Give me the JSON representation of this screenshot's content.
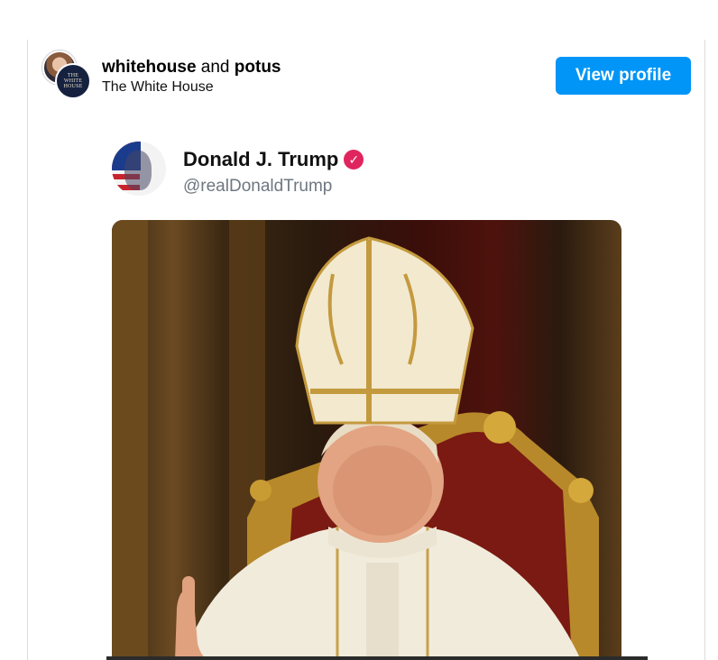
{
  "post": {
    "account1": "whitehouse",
    "joiner": "and",
    "account2": "potus",
    "subtitle": "The White House",
    "avatar_text": "THE WHITE HOUSE",
    "view_profile_label": "View profile"
  },
  "tweet": {
    "name": "Donald J. Trump",
    "handle": "@realDonaldTrump",
    "verified_icon": "verified-badge-icon"
  },
  "colors": {
    "button": "#0095f6",
    "verified": "#e0245e",
    "handle": "#6e7780"
  }
}
